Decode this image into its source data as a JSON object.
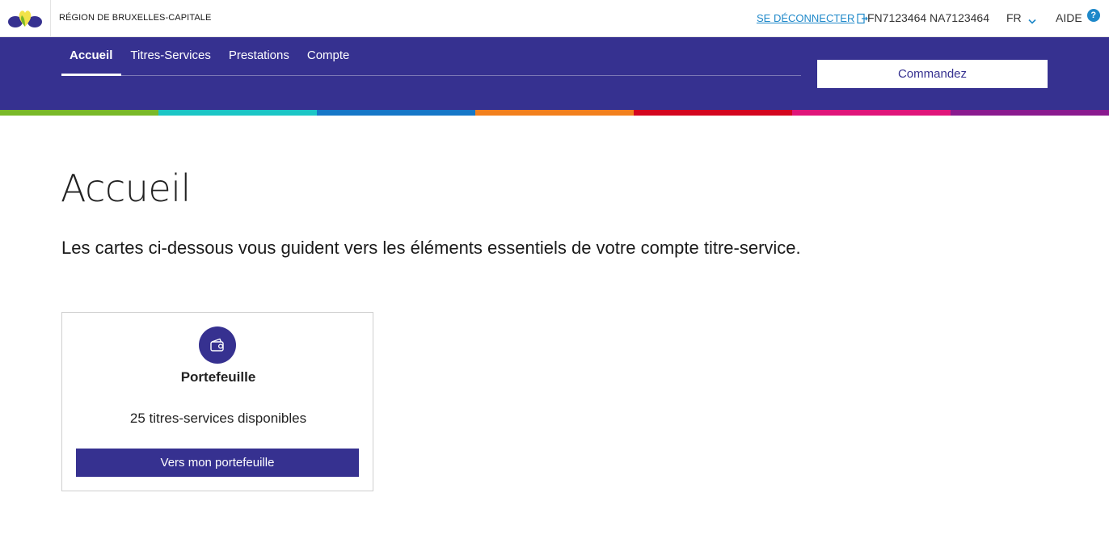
{
  "header": {
    "region": "RÉGION DE BRUXELLES-CAPITALE",
    "logout_label": "SE DÉCONNECTER",
    "account_id": "FN7123464 NA7123464",
    "language": "FR",
    "help_label": "AIDE",
    "help_glyph": "?"
  },
  "nav": {
    "tabs": [
      {
        "label": "Accueil",
        "active": true
      },
      {
        "label": "Titres-Services",
        "active": false
      },
      {
        "label": "Prestations",
        "active": false
      },
      {
        "label": "Compte",
        "active": false
      }
    ],
    "order_button": "Commandez"
  },
  "stripe_colors": [
    "#7ab929",
    "#1cc6c6",
    "#1678c8",
    "#f2801e",
    "#d4061f",
    "#e0157a",
    "#8a1a8f"
  ],
  "colors": {
    "brand": "#363190",
    "link": "#1e88c9"
  },
  "main": {
    "title": "Accueil",
    "intro": "Les cartes ci-dessous vous guident vers les éléments essentiels de votre compte titre-service.",
    "card": {
      "icon": "wallet-icon",
      "title": "Portefeuille",
      "text": "25 titres-services disponibles",
      "button": "Vers mon portefeuille"
    }
  }
}
